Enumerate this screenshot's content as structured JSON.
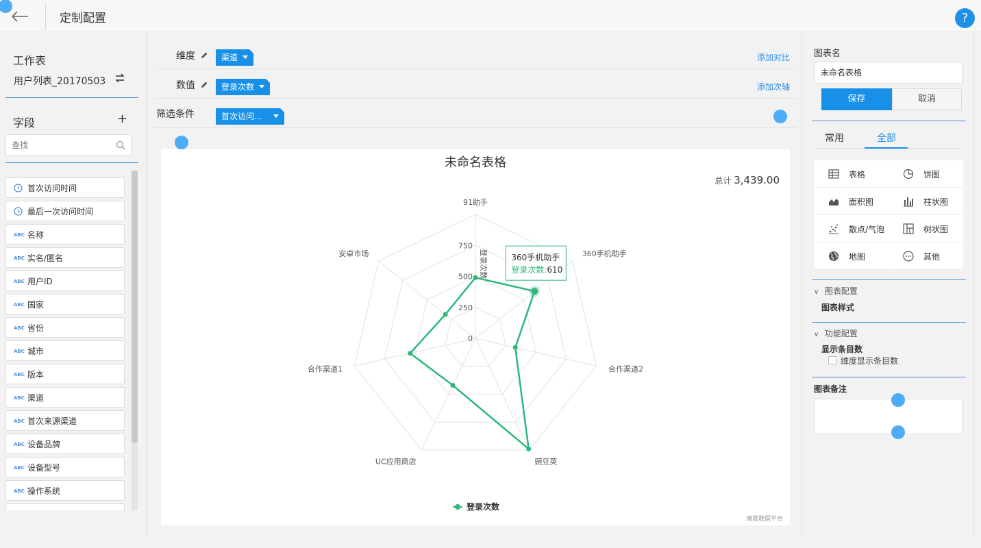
{
  "header": {
    "title": "定制配置",
    "help_label": "?"
  },
  "left": {
    "worksheet_title": "工作表",
    "worksheet_name": "用户列表_20170503",
    "fields_title": "字段",
    "search_placeholder": "查找",
    "fields": [
      {
        "label": "首次访问时间",
        "type": "time"
      },
      {
        "label": "最后一次访问时间",
        "type": "time"
      },
      {
        "label": "名称",
        "type": "text"
      },
      {
        "label": "实名/匿名",
        "type": "text"
      },
      {
        "label": "用户ID",
        "type": "text"
      },
      {
        "label": "国家",
        "type": "text"
      },
      {
        "label": "省份",
        "type": "text"
      },
      {
        "label": "城市",
        "type": "text"
      },
      {
        "label": "版本",
        "type": "text"
      },
      {
        "label": "渠道",
        "type": "text"
      },
      {
        "label": "首次来源渠道",
        "type": "text"
      },
      {
        "label": "设备品牌",
        "type": "text"
      },
      {
        "label": "设备型号",
        "type": "text"
      },
      {
        "label": "操作系统",
        "type": "text"
      },
      {
        "label": "",
        "type": "text"
      }
    ],
    "text_type_icon": "ABC"
  },
  "config": {
    "dimension_label": "维度",
    "dimension_tag": "渠道",
    "add_compare": "添加对比",
    "value_label": "数值",
    "value_tag": "登录次数",
    "add_axis": "添加次轴",
    "filter_label": "筛选条件",
    "filter_tag": "首次访问..."
  },
  "chart": {
    "total_label": "总计",
    "total_value": "3,439.00",
    "tooltip": {
      "title": "360手机助手",
      "series": "登录次数:",
      "value": "610"
    },
    "watermark": "诸葛数据平台",
    "colors": {
      "series": "#2db87a",
      "grid": "#e2e2e2"
    }
  },
  "chart_data": {
    "type": "radar",
    "title": "未命名表格",
    "indicators": [
      "91助手",
      "360手机助手",
      "合作渠道2",
      "豌豆荚",
      "UC应用商店",
      "合作渠道1",
      "安卓市场"
    ],
    "radial_ticks": [
      "0",
      "250",
      "500",
      "750"
    ],
    "radial_label": "登录次数",
    "max": 1000,
    "series": [
      {
        "name": "登录次数",
        "values": [
          490,
          610,
          330,
          990,
          420,
          540,
          310
        ]
      }
    ],
    "legend_position": "bottom"
  },
  "right": {
    "chart_name_label": "图表名",
    "chart_name_value": "未命名表格",
    "save": "保存",
    "cancel": "取消",
    "tab_common": "常用",
    "tab_all": "全部",
    "chart_types": [
      {
        "label": "表格",
        "icon": "table-icon"
      },
      {
        "label": "饼图",
        "icon": "pie-icon"
      },
      {
        "label": "面积图",
        "icon": "area-icon"
      },
      {
        "label": "柱状图",
        "icon": "bar-icon"
      },
      {
        "label": "散点/气泡",
        "icon": "scatter-icon"
      },
      {
        "label": "树状图",
        "icon": "treemap-icon"
      },
      {
        "label": "地图",
        "icon": "globe-icon"
      },
      {
        "label": "其他",
        "icon": "more-icon"
      }
    ],
    "chart_config": "图表配置",
    "chart_style": "图表样式",
    "func_config": "功能配置",
    "show_count": "显示条目数",
    "dim_show_count": "维度显示条目数",
    "chart_note": "图表备注"
  }
}
